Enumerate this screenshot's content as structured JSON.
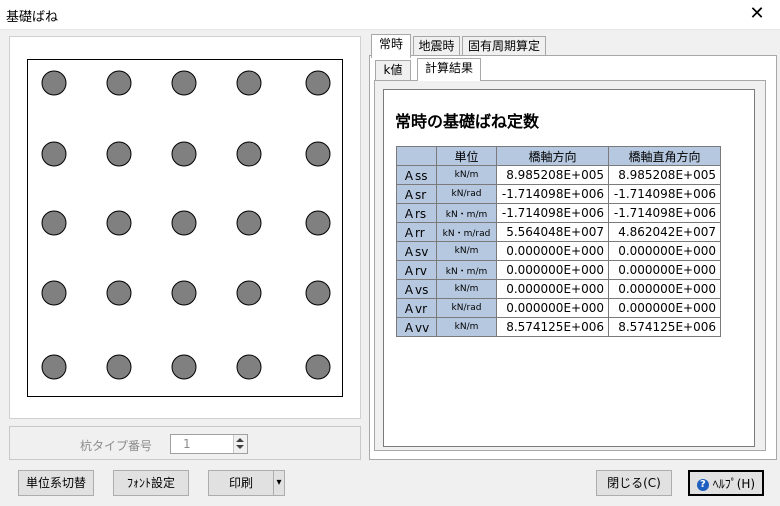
{
  "window": {
    "title": "基礎ばね",
    "close_glyph": "✕"
  },
  "pile_grid": {
    "rows": 5,
    "cols": 5,
    "fill_color": "#808080",
    "stroke_color": "#000000"
  },
  "pile_type": {
    "label": "杭タイプ番号",
    "value": "1"
  },
  "tabs": [
    {
      "label": "常時",
      "active": true
    },
    {
      "label": "地震時",
      "active": false
    },
    {
      "label": "固有周期算定",
      "active": false
    }
  ],
  "subtabs": [
    {
      "label": "k値",
      "active": false
    },
    {
      "label": "計算結果",
      "active": true
    }
  ],
  "section_heading": "常時の基礎ばね定数",
  "table": {
    "headers": [
      "",
      "単位",
      "橋軸方向",
      "橋軸直角方向"
    ],
    "rows": [
      {
        "name": "Ａss",
        "unit": "kN/m",
        "axial": "8.985208E+005",
        "perp": "8.985208E+005"
      },
      {
        "name": "Ａsr",
        "unit": "kN/rad",
        "axial": "-1.714098E+006",
        "perp": "-1.714098E+006"
      },
      {
        "name": "Ａrs",
        "unit": "kN・m/m",
        "axial": "-1.714098E+006",
        "perp": "-1.714098E+006"
      },
      {
        "name": "Ａrr",
        "unit": "kN・m/rad",
        "axial": "5.564048E+007",
        "perp": "4.862042E+007"
      },
      {
        "name": "Ａsv",
        "unit": "kN/m",
        "axial": "0.000000E+000",
        "perp": "0.000000E+000"
      },
      {
        "name": "Ａrv",
        "unit": "kN・m/m",
        "axial": "0.000000E+000",
        "perp": "0.000000E+000"
      },
      {
        "name": "Ａvs",
        "unit": "kN/m",
        "axial": "0.000000E+000",
        "perp": "0.000000E+000"
      },
      {
        "name": "Ａvr",
        "unit": "kN/rad",
        "axial": "0.000000E+000",
        "perp": "0.000000E+000"
      },
      {
        "name": "Ａvv",
        "unit": "kN/m",
        "axial": "8.574125E+006",
        "perp": "8.574125E+006"
      }
    ],
    "header_color": "#b6c8e0"
  },
  "buttons": {
    "unit_switch": "単位系切替",
    "font_settings": "ﾌｫﾝﾄ設定",
    "print": "印刷",
    "print_arrow": "▾",
    "close": "閉じる(C)",
    "help": "ﾍﾙﾌﾟ(H)",
    "help_icon": "?"
  }
}
